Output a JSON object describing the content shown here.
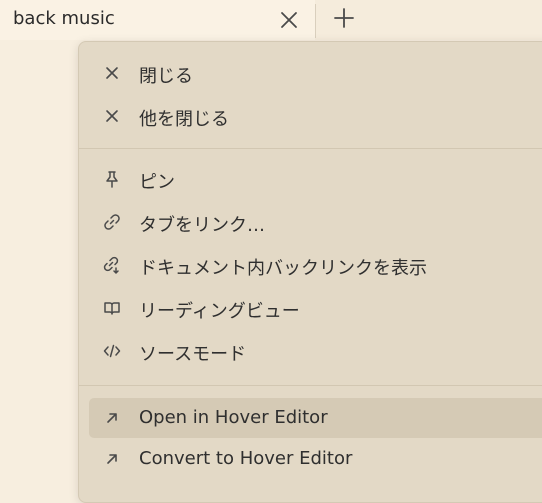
{
  "tab": {
    "title": "back music",
    "close_icon": "close-icon",
    "new_tab_icon": "plus-icon"
  },
  "menu": {
    "groups": [
      [
        {
          "label": "閉じる",
          "icon": "x-icon"
        },
        {
          "label": "他を閉じる",
          "icon": "x-icon"
        }
      ],
      [
        {
          "label": "ピン",
          "icon": "pin-icon"
        },
        {
          "label": "タブをリンク…",
          "icon": "link-icon"
        },
        {
          "label": "ドキュメント内バックリンクを表示",
          "icon": "backlink-icon"
        },
        {
          "label": "リーディングビュー",
          "icon": "book-open-icon"
        },
        {
          "label": "ソースモード",
          "icon": "code-icon"
        }
      ],
      [
        {
          "label": "Open in Hover Editor",
          "icon": "arrow-up-right-icon",
          "highlighted": true
        },
        {
          "label": "Convert to Hover Editor",
          "icon": "arrow-up-right-icon"
        }
      ]
    ]
  },
  "colors": {
    "background": "#f7eedf",
    "menu_background": "#e3d9c6",
    "highlight": "#d5cab5",
    "text": "#2f2f2f"
  }
}
